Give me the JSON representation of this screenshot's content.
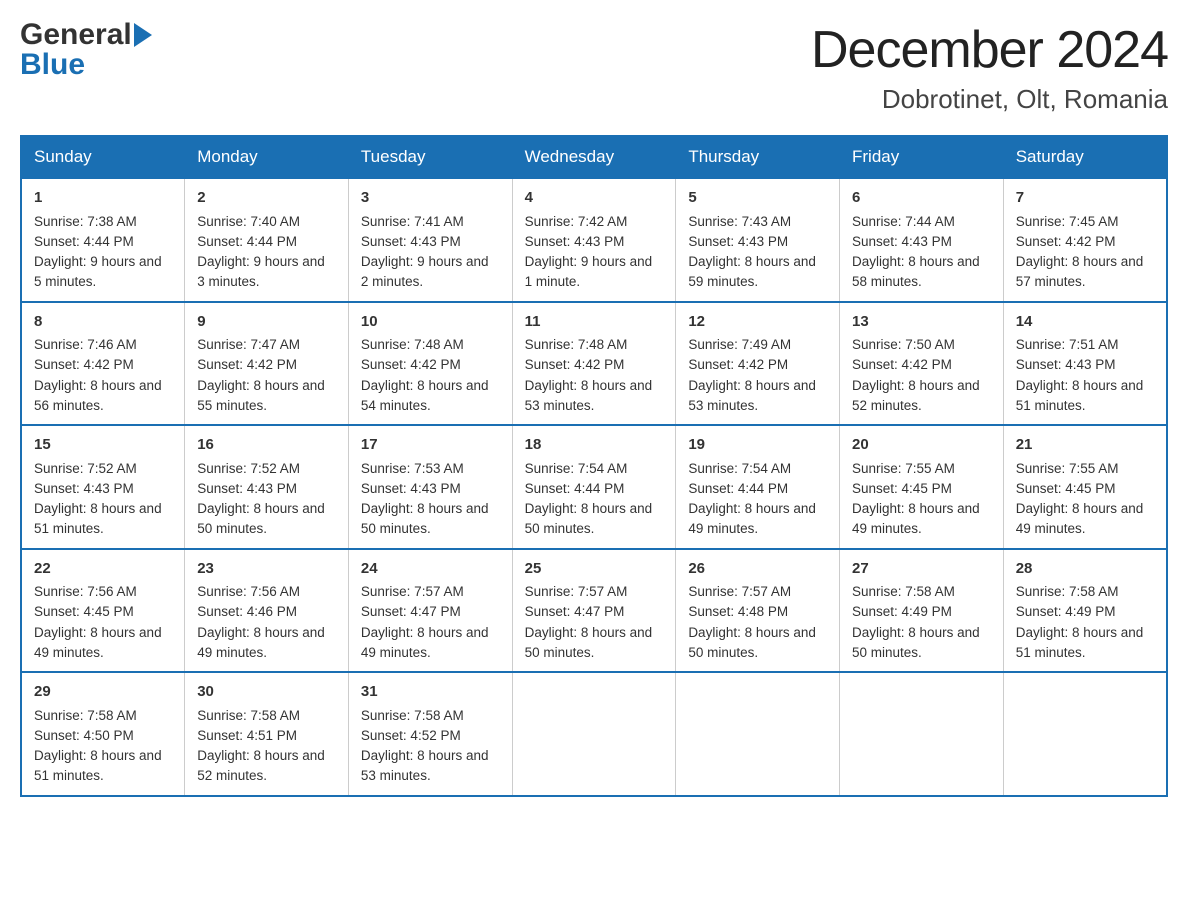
{
  "header": {
    "logo_general": "General",
    "logo_blue": "Blue",
    "month_title": "December 2024",
    "location": "Dobrotinet, Olt, Romania"
  },
  "days_of_week": [
    "Sunday",
    "Monday",
    "Tuesday",
    "Wednesday",
    "Thursday",
    "Friday",
    "Saturday"
  ],
  "weeks": [
    [
      {
        "day": "1",
        "sunrise": "7:38 AM",
        "sunset": "4:44 PM",
        "daylight": "9 hours and 5 minutes."
      },
      {
        "day": "2",
        "sunrise": "7:40 AM",
        "sunset": "4:44 PM",
        "daylight": "9 hours and 3 minutes."
      },
      {
        "day": "3",
        "sunrise": "7:41 AM",
        "sunset": "4:43 PM",
        "daylight": "9 hours and 2 minutes."
      },
      {
        "day": "4",
        "sunrise": "7:42 AM",
        "sunset": "4:43 PM",
        "daylight": "9 hours and 1 minute."
      },
      {
        "day": "5",
        "sunrise": "7:43 AM",
        "sunset": "4:43 PM",
        "daylight": "8 hours and 59 minutes."
      },
      {
        "day": "6",
        "sunrise": "7:44 AM",
        "sunset": "4:43 PM",
        "daylight": "8 hours and 58 minutes."
      },
      {
        "day": "7",
        "sunrise": "7:45 AM",
        "sunset": "4:42 PM",
        "daylight": "8 hours and 57 minutes."
      }
    ],
    [
      {
        "day": "8",
        "sunrise": "7:46 AM",
        "sunset": "4:42 PM",
        "daylight": "8 hours and 56 minutes."
      },
      {
        "day": "9",
        "sunrise": "7:47 AM",
        "sunset": "4:42 PM",
        "daylight": "8 hours and 55 minutes."
      },
      {
        "day": "10",
        "sunrise": "7:48 AM",
        "sunset": "4:42 PM",
        "daylight": "8 hours and 54 minutes."
      },
      {
        "day": "11",
        "sunrise": "7:48 AM",
        "sunset": "4:42 PM",
        "daylight": "8 hours and 53 minutes."
      },
      {
        "day": "12",
        "sunrise": "7:49 AM",
        "sunset": "4:42 PM",
        "daylight": "8 hours and 53 minutes."
      },
      {
        "day": "13",
        "sunrise": "7:50 AM",
        "sunset": "4:42 PM",
        "daylight": "8 hours and 52 minutes."
      },
      {
        "day": "14",
        "sunrise": "7:51 AM",
        "sunset": "4:43 PM",
        "daylight": "8 hours and 51 minutes."
      }
    ],
    [
      {
        "day": "15",
        "sunrise": "7:52 AM",
        "sunset": "4:43 PM",
        "daylight": "8 hours and 51 minutes."
      },
      {
        "day": "16",
        "sunrise": "7:52 AM",
        "sunset": "4:43 PM",
        "daylight": "8 hours and 50 minutes."
      },
      {
        "day": "17",
        "sunrise": "7:53 AM",
        "sunset": "4:43 PM",
        "daylight": "8 hours and 50 minutes."
      },
      {
        "day": "18",
        "sunrise": "7:54 AM",
        "sunset": "4:44 PM",
        "daylight": "8 hours and 50 minutes."
      },
      {
        "day": "19",
        "sunrise": "7:54 AM",
        "sunset": "4:44 PM",
        "daylight": "8 hours and 49 minutes."
      },
      {
        "day": "20",
        "sunrise": "7:55 AM",
        "sunset": "4:45 PM",
        "daylight": "8 hours and 49 minutes."
      },
      {
        "day": "21",
        "sunrise": "7:55 AM",
        "sunset": "4:45 PM",
        "daylight": "8 hours and 49 minutes."
      }
    ],
    [
      {
        "day": "22",
        "sunrise": "7:56 AM",
        "sunset": "4:45 PM",
        "daylight": "8 hours and 49 minutes."
      },
      {
        "day": "23",
        "sunrise": "7:56 AM",
        "sunset": "4:46 PM",
        "daylight": "8 hours and 49 minutes."
      },
      {
        "day": "24",
        "sunrise": "7:57 AM",
        "sunset": "4:47 PM",
        "daylight": "8 hours and 49 minutes."
      },
      {
        "day": "25",
        "sunrise": "7:57 AM",
        "sunset": "4:47 PM",
        "daylight": "8 hours and 50 minutes."
      },
      {
        "day": "26",
        "sunrise": "7:57 AM",
        "sunset": "4:48 PM",
        "daylight": "8 hours and 50 minutes."
      },
      {
        "day": "27",
        "sunrise": "7:58 AM",
        "sunset": "4:49 PM",
        "daylight": "8 hours and 50 minutes."
      },
      {
        "day": "28",
        "sunrise": "7:58 AM",
        "sunset": "4:49 PM",
        "daylight": "8 hours and 51 minutes."
      }
    ],
    [
      {
        "day": "29",
        "sunrise": "7:58 AM",
        "sunset": "4:50 PM",
        "daylight": "8 hours and 51 minutes."
      },
      {
        "day": "30",
        "sunrise": "7:58 AM",
        "sunset": "4:51 PM",
        "daylight": "8 hours and 52 minutes."
      },
      {
        "day": "31",
        "sunrise": "7:58 AM",
        "sunset": "4:52 PM",
        "daylight": "8 hours and 53 minutes."
      },
      null,
      null,
      null,
      null
    ]
  ],
  "labels": {
    "sunrise": "Sunrise:",
    "sunset": "Sunset:",
    "daylight": "Daylight:"
  }
}
